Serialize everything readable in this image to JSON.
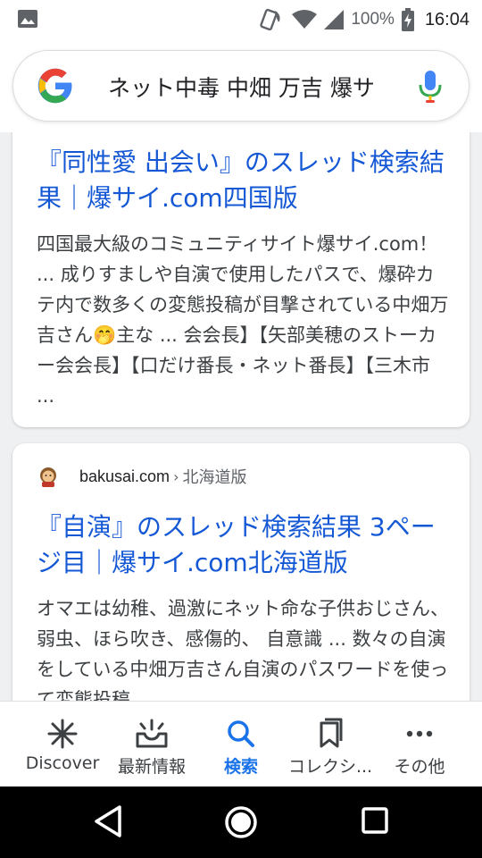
{
  "status_bar": {
    "battery_percent": "100%",
    "time": "16:04"
  },
  "search": {
    "query": "ネット中毒 中畑 万吉 爆サ"
  },
  "results": [
    {
      "title": "『同性愛 出会い』のスレッド検索結果｜爆サイ.com四国版",
      "snippet": "四国最大級のコミュニティサイト爆サイ.com！ ... 成りすましや自演で使用したパスで、爆砕カテ内で数多くの変態投稿が目撃されている中畑万吉さん🤭主な ... 会会長】【矢部美穂のストーカー会会長】【口だけ番長・ネット番長】【三木市 ..."
    },
    {
      "site_domain": "bakusai.com",
      "site_separator": "›",
      "site_path": "北海道版",
      "title": "『自演』のスレッド検索結果 3ページ目｜爆サイ.com北海道版",
      "snippet": "オマエは幼稚、過激にネット命な子供おじさん、弱虫、ほら吹き、感傷的、 自意識 ... 数々の自演をしている中畑万吉さん自演のパスワードを使って変態投稿"
    }
  ],
  "bottom_nav": [
    {
      "label": "Discover",
      "icon": "asterisk-icon"
    },
    {
      "label": "最新情報",
      "icon": "updates-tray-icon"
    },
    {
      "label": "検索",
      "icon": "search-icon",
      "active": true
    },
    {
      "label": "コレクシ...",
      "icon": "bookmark-icon"
    },
    {
      "label": "その他",
      "icon": "more-icon"
    }
  ],
  "colors": {
    "link": "#1558d6",
    "active_nav": "#1a73e8",
    "text": "#3c4043"
  }
}
